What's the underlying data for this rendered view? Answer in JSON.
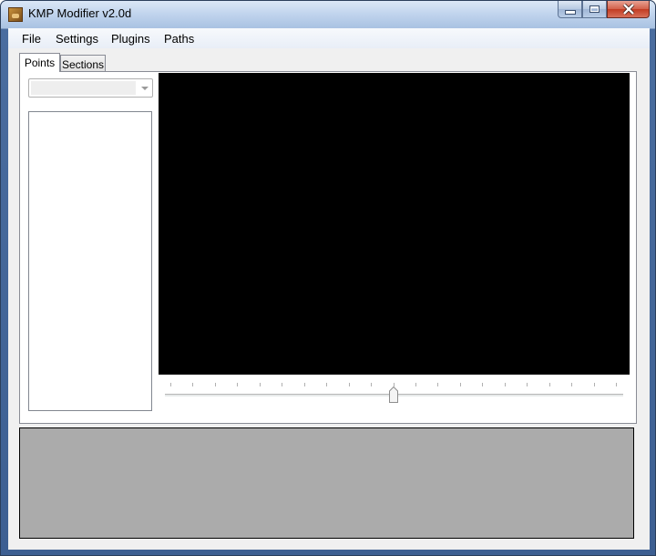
{
  "window": {
    "title": "KMP Modifier v2.0d",
    "icon": "app-icon",
    "caption_buttons": [
      "minimize",
      "maximize",
      "close"
    ]
  },
  "menu": {
    "items": [
      {
        "label": "File"
      },
      {
        "label": "Settings"
      },
      {
        "label": "Plugins"
      },
      {
        "label": "Paths"
      }
    ]
  },
  "tabs": [
    {
      "label": "Points",
      "active": true
    },
    {
      "label": "Sections",
      "active": false
    }
  ],
  "points_tab": {
    "combo": {
      "value": "",
      "enabled": false
    },
    "list": {
      "items": []
    },
    "viewport": {
      "background": "#000000"
    },
    "trackbar": {
      "min": 0,
      "max": 20,
      "value": 10
    }
  },
  "bottom_panel": {
    "background": "#ababab"
  }
}
